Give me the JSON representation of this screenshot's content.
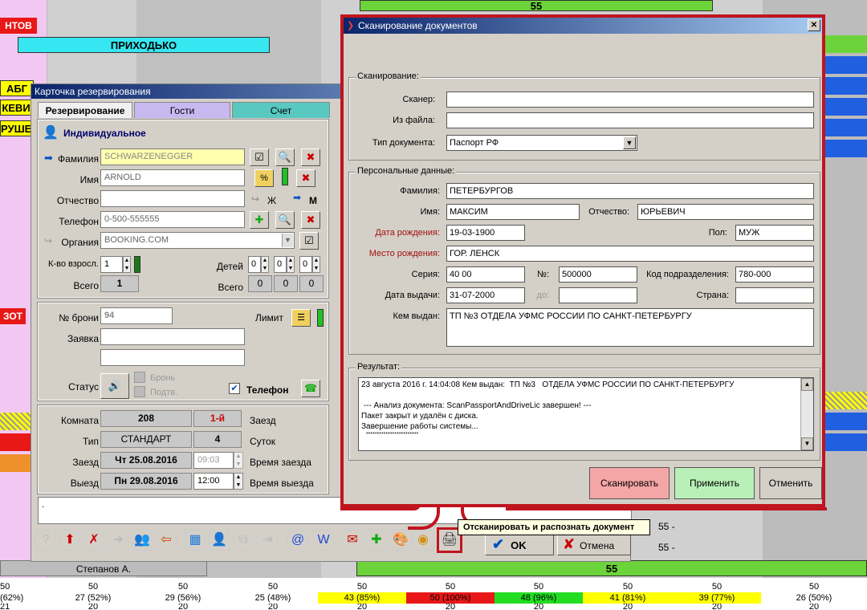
{
  "background": {
    "top_bar_label": "55",
    "left_tags": [
      "НТОВ",
      "АБГ",
      "КЕВИ",
      "РУШЕ",
      "ЗОТ"
    ],
    "bar_prikhodko": "ПРИХОДЬКО",
    "bar_stepanov": "Степанов А.",
    "bar_bottom_55": "55",
    "right_labels": [
      "55 -",
      "55 -"
    ],
    "bottom_row1": [
      "50",
      "50",
      "50",
      "50",
      "50",
      "50",
      "50",
      "50",
      "50",
      "50"
    ],
    "bottom_row2": [
      "(62%)",
      "27 (52%)",
      "29 (56%)",
      "25 (48%)",
      "43 (85%)",
      "50 (100%)",
      "48 (96%)",
      "41 (81%)",
      "39 (77%)",
      "26 (50%)"
    ],
    "bottom_row3": [
      "21",
      "20",
      "20",
      "20",
      "20",
      "20",
      "20",
      "20",
      "20",
      "20"
    ]
  },
  "card": {
    "title": "Карточка резервирования",
    "tabs": [
      "Резервирование",
      "Гости",
      "Счет"
    ],
    "type_label": "Индивидуальное",
    "surname_label": "Фамилия",
    "surname_value": "SCHWARZENEGGER",
    "name_label": "Имя",
    "name_value": "ARNOLD",
    "patronymic_label": "Отчество",
    "patronymic_value": "",
    "gender_f": "Ж",
    "gender_m": "М",
    "phone_label": "Телефон",
    "phone_value": "0-500-555555",
    "org_label": "Органия",
    "org_value": "BOOKING.COM",
    "adults_label": "К-во взросл.",
    "adults_value": "1",
    "children_label": "Детей",
    "children_values": [
      "0",
      "0",
      "0"
    ],
    "total_label": "Всего",
    "total_value": "1",
    "total_children_values": [
      "0",
      "0",
      "0"
    ],
    "booking_no_label": "№ брони",
    "booking_no_value": "94",
    "limit_label": "Лимит",
    "request_label": "Заявка",
    "status_label": "Статус",
    "bron_label": "Бронь",
    "podtv_label": "Подтв.",
    "phone_check_label": "Телефон",
    "room_label": "Комната",
    "room_value": "208",
    "floor_value": "1-й",
    "arrival_word": "Заезд",
    "type_room_label": "Тип",
    "type_room_value": "СТАНДАРТ",
    "nights_value": "4",
    "nights_label": "Суток",
    "checkin_label": "Заезд",
    "checkin_date": "Чт 25.08.2016",
    "checkin_time": "09:03",
    "checkin_time_label": "Время заезда",
    "checkout_label": "Выезд",
    "checkout_date": "Пн 29.08.2016",
    "checkout_time": "12:00",
    "checkout_time_label": "Время выезда",
    "comment": "."
  },
  "dialog": {
    "title": "Сканирование документов",
    "close": "✕",
    "scan_group": "Сканирование:",
    "scanner_label": "Сканер:",
    "scanner_value": "",
    "file_label": "Из файла:",
    "file_value": "",
    "doctype_label": "Тип документа:",
    "doctype_value": "Паспорт РФ",
    "personal_group": "Персональные данные:",
    "surname_label": "Фамилия:",
    "surname_value": "ПЕТЕРБУРГОВ",
    "name_label": "Имя:",
    "name_value": "МАКСИМ",
    "patronymic_label": "Отчество:",
    "patronymic_value": "ЮРЬЕВИЧ",
    "dob_label": "Дата рождения:",
    "dob_value": "19-03-1900",
    "sex_label": "Пол:",
    "sex_value": "МУЖ",
    "pob_label": "Место рождения:",
    "pob_value": "ГОР. ЛЕНСК",
    "series_label": "Серия:",
    "series_value": "40 00",
    "number_label": "№:",
    "number_value": "500000",
    "subdiv_label": "Код подразделения:",
    "subdiv_value": "780-000",
    "issue_label": "Дата выдачи:",
    "issue_value": "31-07-2000",
    "until_label": "до:",
    "until_value": "",
    "country_label": "Страна:",
    "country_value": "",
    "issuer_label": "Кем выдан:",
    "issuer_value": "ТП №3  ОТДЕЛА УФМС РОССИИ ПО САНКТ-ПЕТЕРБУРГУ",
    "result_group": "Результат:",
    "result_lines": [
      "23 августа 2016 г. 14:04:08 Кем выдан:  ТП №3   ОТДЕЛА УФМС РОССИИ ПО САНКТ-ПЕТЕРБУРГУ",
      "",
      " --- Анализ документа: ScanPassportAndDriveLic завершен! ---",
      "Пакет закрыт и удалён с диска.",
      "Завершение работы системы...",
      "   ************************"
    ],
    "btn_scan": "Сканировать",
    "btn_apply": "Применить",
    "btn_cancel": "Отменить"
  },
  "tooltip": "Отсканировать и распознать документ",
  "ok_label": "OK",
  "cancel_label": "Отмена",
  "colors": {
    "accent_red": "#c0141e",
    "scan_btn": "#f4a6a6",
    "apply_btn": "#b8f0b8"
  }
}
